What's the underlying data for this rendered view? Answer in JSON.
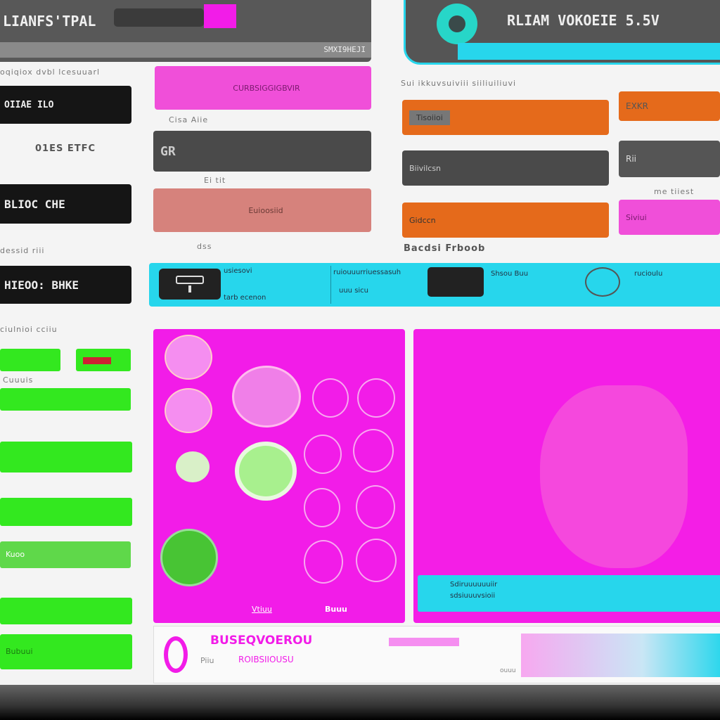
{
  "header_left": {
    "title": "LIANFS'TPAL",
    "status": "SMXI9HEJI"
  },
  "header_right": {
    "title": "RLIAM VOKOEIE 5.5V"
  },
  "left_column": {
    "top_label": "oqiqiox dvbl lcesuuarl",
    "items": [
      {
        "label": "OIIAE ILO",
        "caption": "01ES ETFC"
      },
      {
        "label": "BLIOC CHE",
        "caption": "dessid riii"
      },
      {
        "label": "HIEOO: BHKE",
        "caption": "ciulnioi cciiu"
      }
    ]
  },
  "middle_column": {
    "items": [
      {
        "label": "CURBSIGGIGBVIR",
        "caption": "Cisa Aiie"
      },
      {
        "label": "GR",
        "caption": "Ei tit"
      },
      {
        "label": "Euioosiid",
        "caption": "dss"
      }
    ]
  },
  "right_column": {
    "top_label": "Sui ikkuvsuiviii siiliuiliuvi",
    "items": [
      {
        "label": "Tisoiioi"
      },
      {
        "label": "Biivilcsn"
      },
      {
        "label": "Gidccn"
      }
    ],
    "side_items": [
      {
        "label": "EXKR"
      },
      {
        "label": "Rii"
      },
      {
        "label": "Siviui"
      }
    ],
    "side_caption": "me tiiest",
    "bottom_caption": "Bacdsi Frboob"
  },
  "toolbar": {
    "texts": [
      "usiesovi",
      "tarb ecenon",
      "ruiouuurriuessasuh",
      "uuu sicu",
      "Shsou Buu",
      "rucioulu"
    ]
  },
  "green_panel": {
    "items": [
      "Cuuuis",
      "Kuoo",
      "Bubuui"
    ]
  },
  "circle_panel": {
    "footer": [
      "Vtiuu",
      "Buuu"
    ]
  },
  "image_panel": {
    "strip_text": [
      "Sdiruuuuuuiir",
      "sdsiuuuvsioii"
    ]
  },
  "bottom_bar": {
    "title": "BUSEQVOEROU",
    "subtitle": "ROIBSIIOUSU",
    "note": "Piiu",
    "code": "ouuu"
  },
  "colors": {
    "magenta": "#f21ce8",
    "cyan": "#27d6ec",
    "green": "#33e81f",
    "orange": "#e56a1b",
    "dark": "#555555"
  }
}
